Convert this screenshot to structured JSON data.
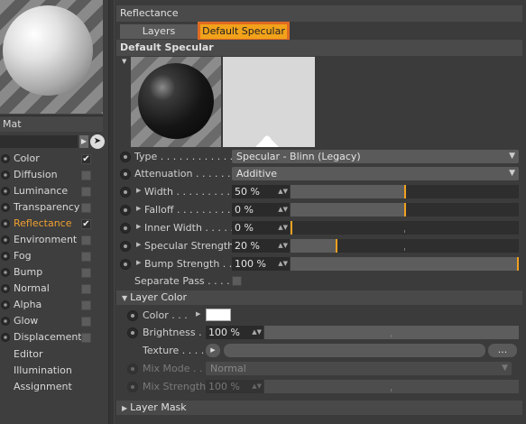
{
  "material": {
    "name": "Mat"
  },
  "channels": [
    {
      "label": "Color",
      "checked": true,
      "active": false
    },
    {
      "label": "Diffusion",
      "checked": false,
      "active": false
    },
    {
      "label": "Luminance",
      "checked": false,
      "active": false
    },
    {
      "label": "Transparency",
      "checked": false,
      "active": false
    },
    {
      "label": "Reflectance",
      "checked": true,
      "active": true
    },
    {
      "label": "Environment",
      "checked": false,
      "active": false
    },
    {
      "label": "Fog",
      "checked": false,
      "active": false
    },
    {
      "label": "Bump",
      "checked": false,
      "active": false
    },
    {
      "label": "Normal",
      "checked": false,
      "active": false
    },
    {
      "label": "Alpha",
      "checked": false,
      "active": false
    },
    {
      "label": "Glow",
      "checked": false,
      "active": false
    },
    {
      "label": "Displacement",
      "checked": false,
      "active": false
    }
  ],
  "channel_labels": [
    "Color",
    "Diffusion",
    "Luminance",
    "Transparency",
    "Reflectance",
    "Environment",
    "Fog",
    "Bump",
    "Normal",
    "Alpha",
    "Glow",
    "Displacement"
  ],
  "extra_items": [
    "Editor",
    "Illumination",
    "Assignment"
  ],
  "header": {
    "title": "Reflectance"
  },
  "tabs": {
    "layers": "Layers",
    "default_specular": "Default Specular"
  },
  "section_title": "Default Specular",
  "fields": {
    "type": {
      "label": "Type",
      "value": "Specular - Blinn (Legacy)"
    },
    "attenuation": {
      "label": "Attenuation",
      "value": "Additive"
    },
    "width": {
      "label": "Width",
      "value": "50 %",
      "level": 0.5
    },
    "falloff": {
      "label": "Falloff",
      "value": "0 %",
      "level": 0.5
    },
    "inner_width": {
      "label": "Inner Width",
      "value": "0 %",
      "level": 0.0
    },
    "specular_strength": {
      "label": "Specular Strength",
      "value": "20 %",
      "level": 0.2
    },
    "bump_strength": {
      "label": "Bump Strength",
      "value": "100 %",
      "level": 1.0
    },
    "separate_pass": {
      "label": "Separate Pass"
    }
  },
  "layer_color": {
    "title": "Layer Color",
    "color_label": "Color",
    "color_value": "#ffffff",
    "brightness_label": "Brightness",
    "brightness_value": "100 %",
    "texture_label": "Texture",
    "texture_browse": "...",
    "mix_mode_label": "Mix Mode",
    "mix_mode_value": "Normal",
    "mix_strength_label": "Mix Strength",
    "mix_strength_value": "100 %"
  },
  "layer_mask": {
    "title": "Layer Mask"
  },
  "colors": {
    "accent": "#f0a020",
    "highlight_border": "#e06b22",
    "active_label": "#f0a030"
  }
}
